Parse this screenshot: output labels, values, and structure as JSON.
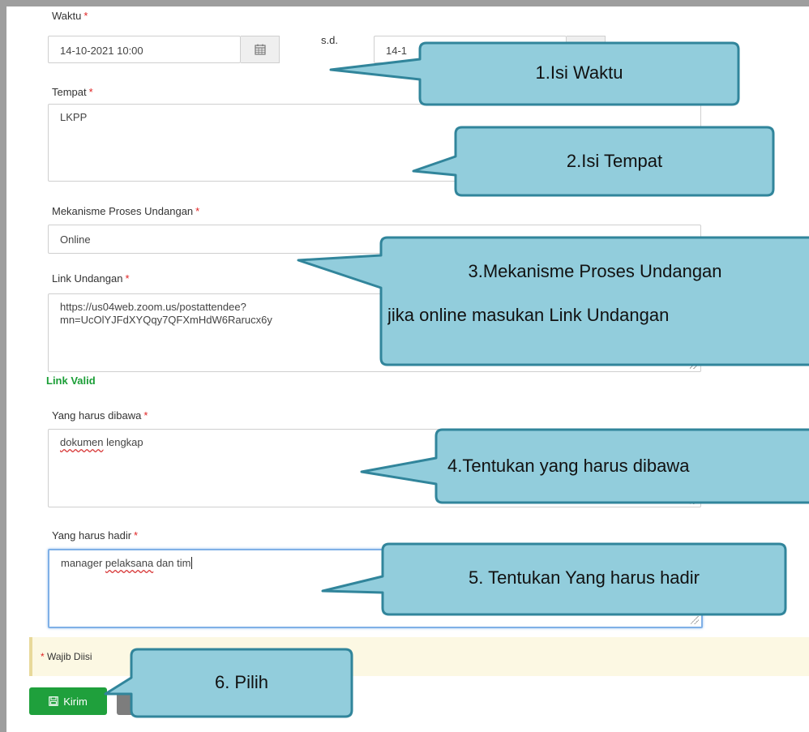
{
  "form": {
    "waktu": {
      "label": "Waktu",
      "required": "*",
      "start": "14-10-2021 10:00",
      "sd": "s.d.",
      "end": "14-1"
    },
    "tempat": {
      "label": "Tempat",
      "required": "*",
      "value": "LKPP"
    },
    "mekanisme": {
      "label": "Mekanisme Proses Undangan",
      "required": "*",
      "value": "Online"
    },
    "link": {
      "label": "Link Undangan",
      "required": "*",
      "line1": "https://us04web.zoom.us/postattendee?",
      "line2": "mn=UcOlYJFdXYQqy7QFXmHdW6Rarucx6y",
      "valid": "Link Valid"
    },
    "dibawa": {
      "label": "Yang harus dibawa",
      "required": "*",
      "word1": "dokumen",
      "word2": " lengkap"
    },
    "hadir": {
      "label": "Yang harus hadir",
      "required": "*",
      "part1": "manager ",
      "part2": "pelaksana",
      "part3": " dan tim"
    },
    "note": {
      "star": "*",
      "text": " Wajib Diisi"
    },
    "kirim_label": "Kirim"
  },
  "callouts": {
    "c1": "1.Isi Waktu",
    "c2": "2.Isi Tempat",
    "c3_line1": "3.Mekanisme Proses Undangan",
    "c3_line2": "jika online masukan Link Undangan",
    "c4": "4.Tentukan yang harus dibawa",
    "c5": "5. Tentukan Yang harus hadir",
    "c6": "6. Pilih"
  },
  "colors": {
    "callout_fill": "#92cddc",
    "callout_stroke": "#31859b",
    "success": "#1fa03c",
    "required": "#e02424"
  },
  "icons": {
    "calendar": "calendar-icon",
    "save": "floppy-disk-icon",
    "dropdown": "chevron-down-icon"
  }
}
